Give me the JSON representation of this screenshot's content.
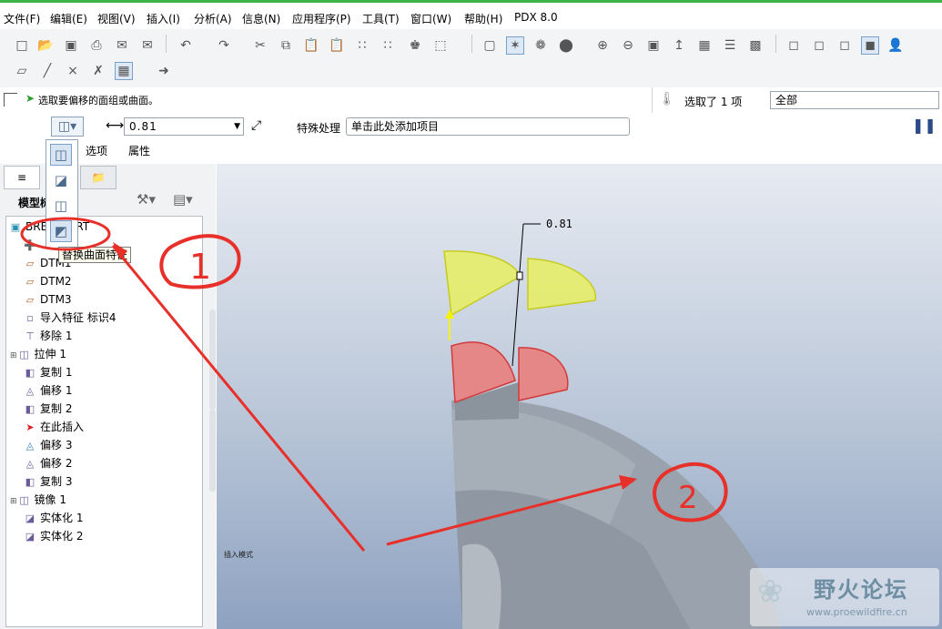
{
  "menu": [
    "文件(F)",
    "编辑(E)",
    "视图(V)",
    "插入(I)",
    "分析(A)",
    "信息(N)",
    "应用程序(P)",
    "工具(T)",
    "窗口(W)",
    "帮助(H)",
    "PDX 8.0"
  ],
  "message": {
    "prompt": "选取要偏移的面组或曲面。",
    "selected": "选取了 1 项",
    "filter": "全部"
  },
  "dashboard": {
    "offset_value": "0.81",
    "special_label": "特殊处理",
    "special_value": "单击此处添加项目",
    "tabs": [
      "选项",
      "属性"
    ]
  },
  "flyout": {
    "tooltip": "替换曲面特征"
  },
  "panel": {
    "title": "模型树"
  },
  "tree": [
    {
      "icon": "part-icon",
      "label": "BRE____PRT"
    },
    {
      "icon": "csys-icon",
      "label": ""
    },
    {
      "icon": "datum-plane-icon",
      "label": "DTM1"
    },
    {
      "icon": "datum-plane-icon",
      "label": "DTM2"
    },
    {
      "icon": "datum-plane-icon",
      "label": "DTM3"
    },
    {
      "icon": "import-icon",
      "label": "导入特征 标识4"
    },
    {
      "icon": "remove-icon",
      "label": "移除 1"
    },
    {
      "icon": "extrude-icon",
      "label": "拉伸 1"
    },
    {
      "icon": "copy-icon",
      "label": "复制 1"
    },
    {
      "icon": "offset-icon",
      "label": "偏移 1"
    },
    {
      "icon": "copy-icon",
      "label": "复制 2"
    },
    {
      "icon": "insert-here-icon",
      "label": "在此插入"
    },
    {
      "icon": "offset-icon",
      "label": "偏移 3"
    },
    {
      "icon": "offset-icon",
      "label": "偏移 2"
    },
    {
      "icon": "copy-icon",
      "label": "复制 3"
    },
    {
      "icon": "mirror-icon",
      "label": "镜像 1"
    },
    {
      "icon": "solidify-icon",
      "label": "实体化 1"
    },
    {
      "icon": "solidify-icon",
      "label": "实体化 2"
    }
  ],
  "viewport": {
    "dimension": "0.81",
    "mode_text": "插入模式",
    "annotation_1": "1",
    "annotation_2": "2"
  },
  "watermark": {
    "name": "野火论坛",
    "url": "www.proewildfire.cn"
  },
  "colors": {
    "accent_green": "#3fb24a",
    "annotation_red": "#e8302a",
    "highlight_yellow": "#e8ef60",
    "selected_red": "#e58787"
  }
}
